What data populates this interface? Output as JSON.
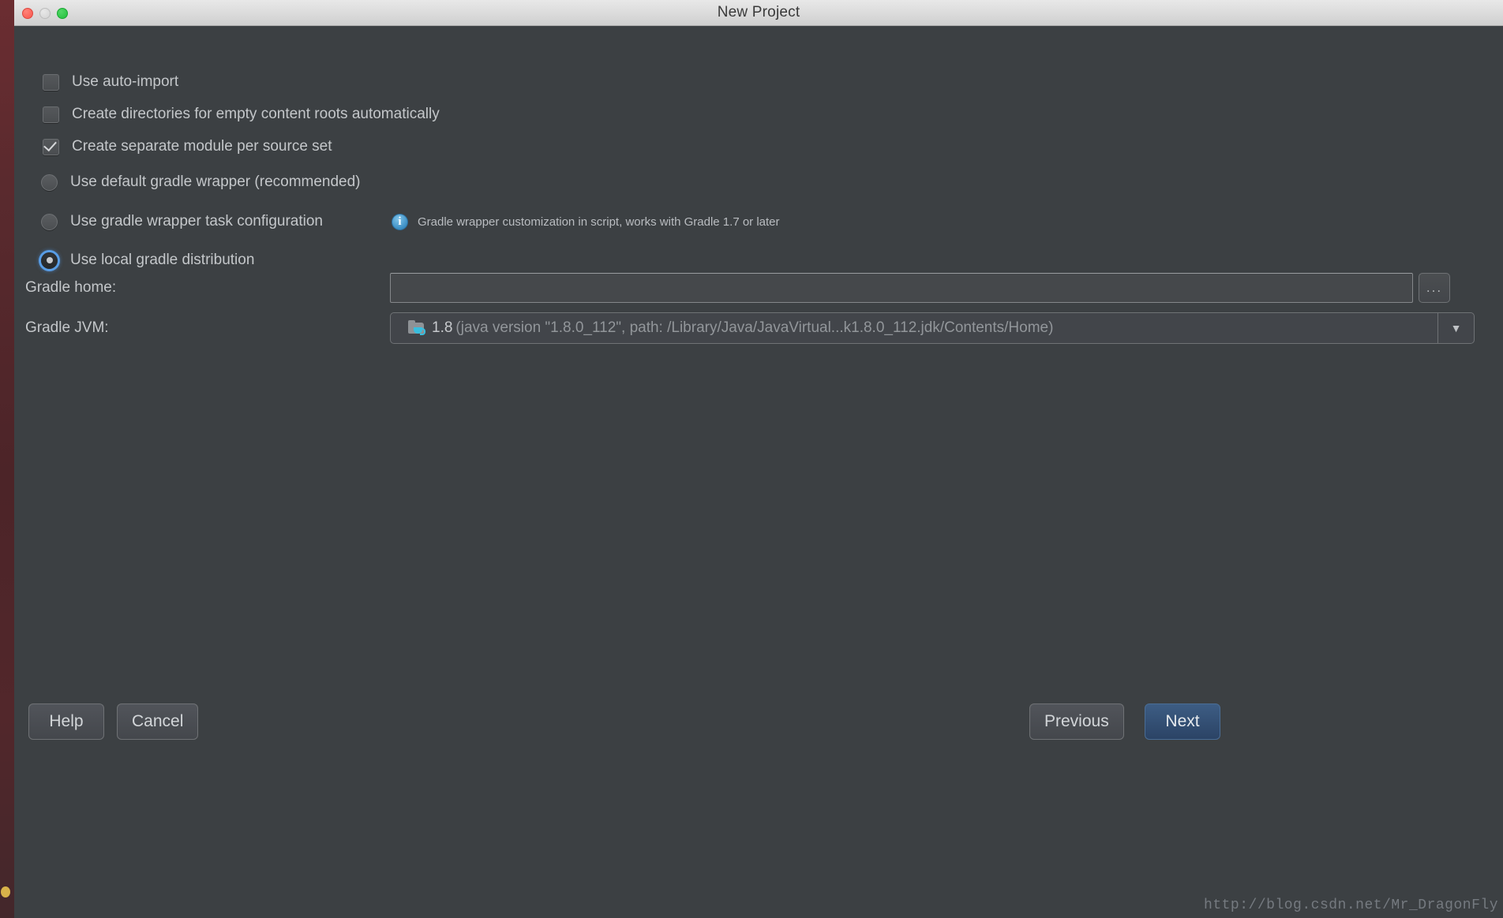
{
  "window": {
    "title": "New Project",
    "traffic_lights": [
      "close-button",
      "minimize-button",
      "maximize-button"
    ]
  },
  "options": [
    {
      "type": "checkbox",
      "label": "Use auto-import",
      "checked": false
    },
    {
      "type": "checkbox",
      "label": "Create directories for empty content roots automatically",
      "checked": false
    },
    {
      "type": "checkbox",
      "label": "Create separate module per source set",
      "checked": true
    },
    {
      "type": "radio",
      "label": "Use default gradle wrapper (recommended)",
      "checked": false
    },
    {
      "type": "radio",
      "label": "Use gradle wrapper task configuration",
      "checked": false
    },
    {
      "type": "radio",
      "label": "Use local gradle distribution",
      "checked": true
    }
  ],
  "hint": {
    "icon": "info-icon",
    "glyph": "i",
    "text": "Gradle wrapper customization in script, works with Gradle 1.7 or later"
  },
  "fields": {
    "gradle_home": {
      "label": "Gradle home:",
      "value": "",
      "placeholder": "",
      "browse_label": "..."
    },
    "gradle_jvm": {
      "label": "Gradle JVM:",
      "icon": "jdk-folder-icon",
      "version": "1.8",
      "detail": "(java version \"1.8.0_112\", path: /Library/Java/JavaVirtual...k1.8.0_112.jdk/Contents/Home)",
      "arrow": "▼"
    }
  },
  "buttons": {
    "help": "Help",
    "cancel": "Cancel",
    "previous": "Previous",
    "next": "Next"
  },
  "watermark": "http://blog.csdn.net/Mr_DragonFly",
  "colors": {
    "dialog_bg": "#3c4043",
    "titlebar_bg": "#dcdcdc",
    "text": "#c4c7ca",
    "muted_text": "#92969a",
    "accent_blue": "#5aa0eb",
    "default_button": "#3d5d84",
    "info_blue": "#3d8fc4",
    "jdk_cup": "#39bede",
    "backdrop": "#5a2a2e"
  }
}
